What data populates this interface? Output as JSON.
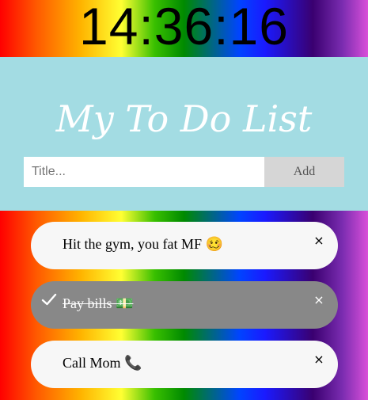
{
  "clock": {
    "time": "14:36:16"
  },
  "header": {
    "title": "My To Do List",
    "input_placeholder": "Title...",
    "input_value": "",
    "add_label": "Add"
  },
  "todos": [
    {
      "text": "Hit the gym, you fat MF 🥴",
      "checked": false,
      "close_label": "×"
    },
    {
      "text": "Pay bills 💵",
      "checked": true,
      "close_label": "×"
    },
    {
      "text": "Call Mom 📞",
      "checked": false,
      "close_label": "×"
    }
  ],
  "colors": {
    "header_bg": "#a3dce3",
    "item_bg": "#f7f7f7",
    "item_checked_bg": "#888888",
    "add_button_bg": "#d6d6d6"
  }
}
